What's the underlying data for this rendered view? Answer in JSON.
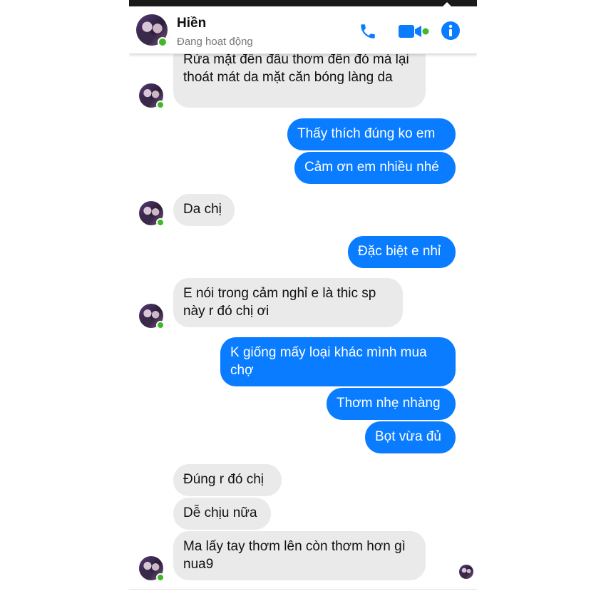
{
  "header": {
    "contact_name": "Hiền",
    "contact_status": "Đang hoạt động",
    "icons": [
      "phone-icon",
      "video-call-icon",
      "info-icon"
    ]
  },
  "colors": {
    "accent": "#0a7cff",
    "incoming_bubble": "#eaeaea",
    "online": "#42b72a"
  },
  "messages": [
    {
      "direction": "in",
      "text": "Rửa mặt đến đâu thơm đến đó mà lại thoát mát da mặt căn bóng làng da"
    },
    {
      "direction": "out",
      "text": "Thấy thích đúng ko em"
    },
    {
      "direction": "out",
      "text": "Cảm ơn em nhiều nhé"
    },
    {
      "direction": "in",
      "text": "Da chị"
    },
    {
      "direction": "out",
      "text": "Đặc biệt e nhỉ"
    },
    {
      "direction": "in",
      "text": "E nói trong cảm nghỉ e là thic sp này r đó chị ơi"
    },
    {
      "direction": "out",
      "text": "K giống mấy loại khác mình mua chợ"
    },
    {
      "direction": "out",
      "text": "Thơm nhẹ nhàng"
    },
    {
      "direction": "out",
      "text": "Bọt vừa đủ"
    },
    {
      "direction": "in",
      "text": "Đúng r đó chị"
    },
    {
      "direction": "in",
      "text": "Dễ chịu nữa"
    },
    {
      "direction": "in",
      "text": "Ma lấy tay thơm lên còn thơm hơn gì nua9"
    }
  ]
}
